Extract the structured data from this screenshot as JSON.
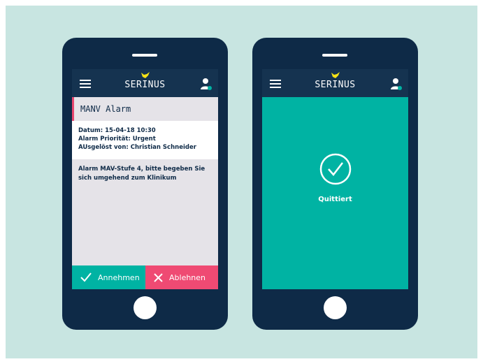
{
  "brand": {
    "name": "SERINUS",
    "accent": "#f5e216",
    "appbar_color": "#153350",
    "phone_color": "#0e2a47",
    "background": "#c8e5e1"
  },
  "left_screen": {
    "alarm_title": "MANV Alarm",
    "details": [
      "Datum: 15-04-18  10:30",
      "Alarm Priorität: Urgent",
      "AUsgelöst von: Christian Schneider"
    ],
    "message": "Alarm MAV-Stufe 4, bitte begeben Sie sich umgehend zum Klinikum",
    "accept_label": "Annehmen",
    "reject_label": "Ablehnen",
    "accept_color": "#00b3a3",
    "reject_color": "#ef4a73",
    "alarm_marker_color": "#e8466f"
  },
  "right_screen": {
    "status_label": "Quittiert",
    "status_icon": "check-circle-icon",
    "background_color": "#00b3a3"
  },
  "icons": {
    "menu": "hamburger-menu-icon",
    "user": "user-check-icon",
    "bird": "bird-logo-icon",
    "accept": "checkmark-icon",
    "reject": "x-icon"
  }
}
